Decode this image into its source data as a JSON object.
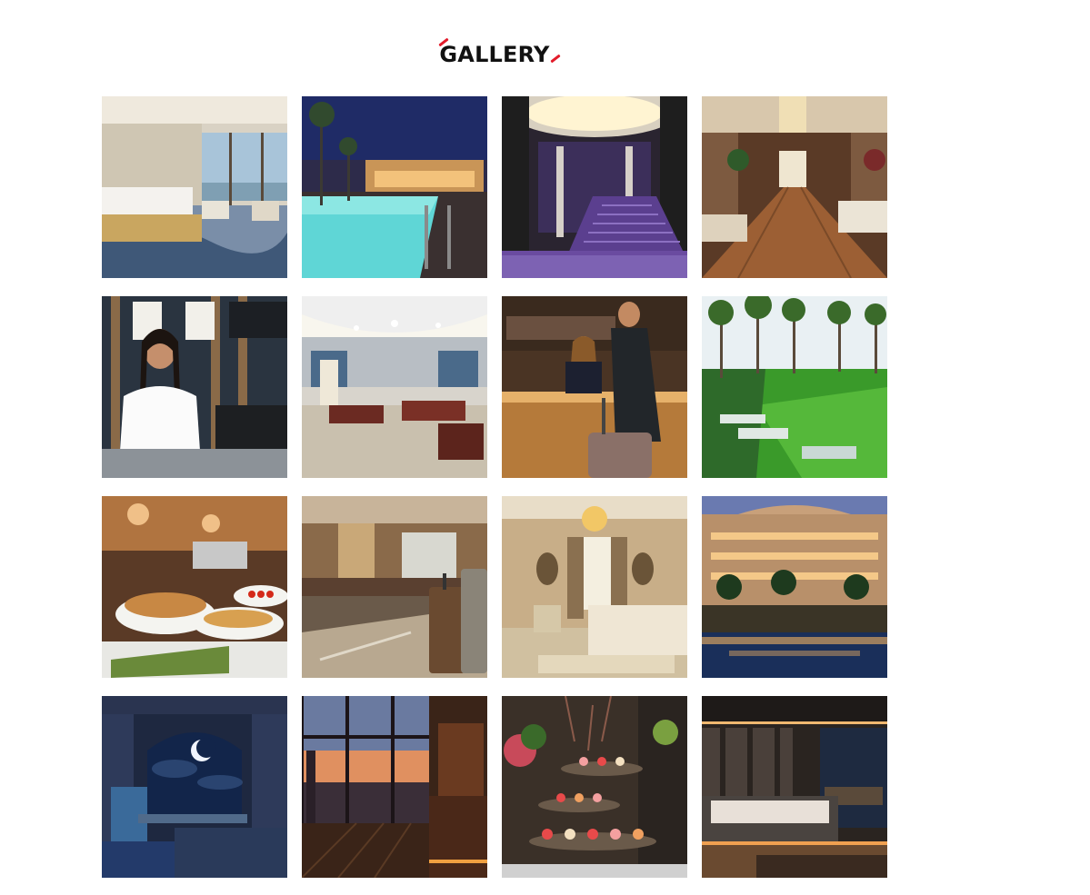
{
  "gallery": {
    "title": "GALLERY",
    "accent_color": "#e21b2a",
    "items": [
      {
        "icon": "luxury-bedroom-image"
      },
      {
        "icon": "night-pool-palms-image"
      },
      {
        "icon": "grand-lobby-staircase-image"
      },
      {
        "icon": "lounge-hall-image"
      },
      {
        "icon": "receptionist-portrait-image"
      },
      {
        "icon": "chandelier-restaurant-image"
      },
      {
        "icon": "reception-check-in-image"
      },
      {
        "icon": "garden-sunbeds-image"
      },
      {
        "icon": "breakfast-buffet-image"
      },
      {
        "icon": "lobby-luggage-image"
      },
      {
        "icon": "classic-suite-image"
      },
      {
        "icon": "hotel-exterior-night-image"
      },
      {
        "icon": "moonlit-window-room-image"
      },
      {
        "icon": "city-sunset-bar-image"
      },
      {
        "icon": "dessert-buffet-image"
      },
      {
        "icon": "modern-bedroom-night-image"
      }
    ]
  }
}
